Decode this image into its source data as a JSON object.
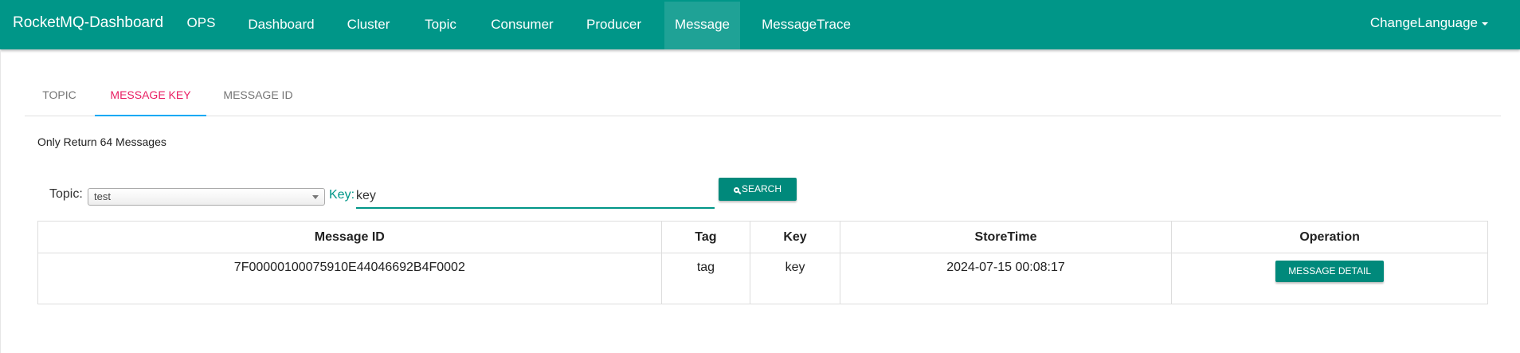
{
  "navbar": {
    "brand": "RocketMQ-Dashboard",
    "items": [
      {
        "label": "OPS"
      },
      {
        "label": "Dashboard"
      },
      {
        "label": "Cluster"
      },
      {
        "label": "Topic"
      },
      {
        "label": "Consumer"
      },
      {
        "label": "Producer"
      },
      {
        "label": "Message"
      },
      {
        "label": "MessageTrace"
      }
    ],
    "active_item": "Message",
    "language_label": "ChangeLanguage",
    "bg_color": "#009688"
  },
  "tabs": [
    {
      "label": "TOPIC"
    },
    {
      "label": "MESSAGE KEY"
    },
    {
      "label": "MESSAGE ID"
    }
  ],
  "active_tab": "MESSAGE KEY",
  "notice": "Only Return 64 Messages",
  "search": {
    "topic_label": "Topic:",
    "topic_value": "test",
    "key_label": "Key:",
    "key_value": "key",
    "button_label": "SEARCH"
  },
  "table": {
    "columns": [
      "Message ID",
      "Tag",
      "Key",
      "StoreTime",
      "Operation"
    ],
    "rows": [
      {
        "message_id": "7F00000100075910E44046692B4F0002",
        "tag": "tag",
        "key": "key",
        "store_time": "2024-07-15 00:08:17",
        "action_label": "MESSAGE DETAIL"
      }
    ]
  },
  "colors": {
    "accent": "#009688",
    "button": "#00897b",
    "active_tab_text": "#e91e63",
    "active_tab_underline": "#03a9f4"
  }
}
